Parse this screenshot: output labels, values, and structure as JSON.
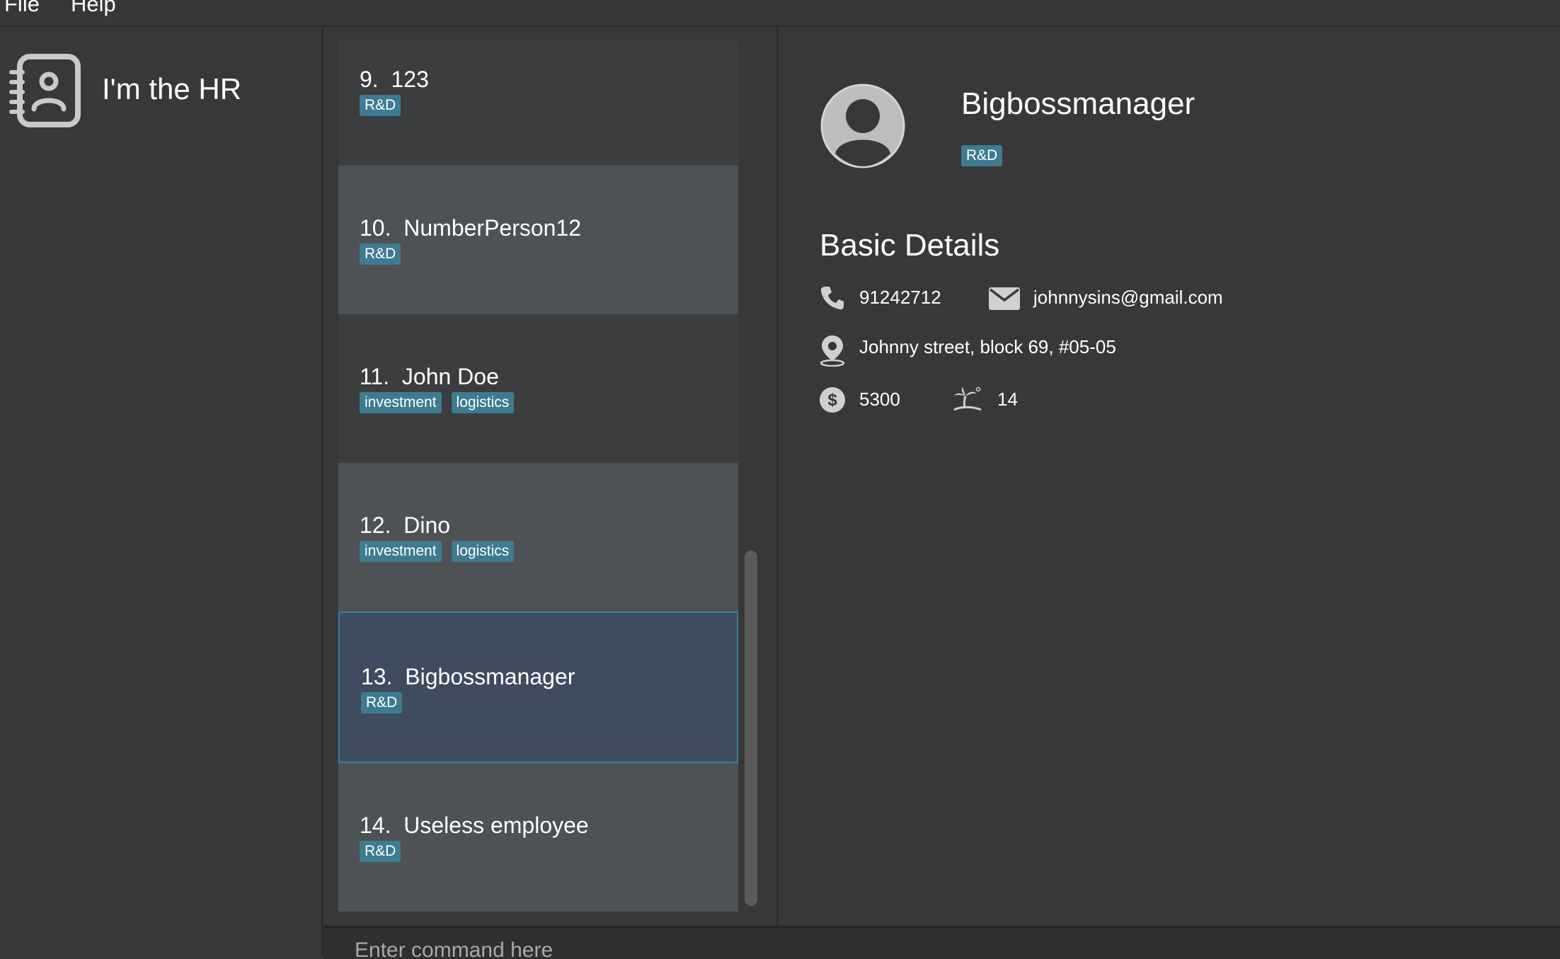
{
  "menu": {
    "items": [
      {
        "label": "File"
      },
      {
        "label": "Help"
      }
    ]
  },
  "sidebar": {
    "title": "I'm the HR",
    "logo_icon": "address-book-icon"
  },
  "persons": [
    {
      "index": "9.",
      "name": "123",
      "tags": [
        "R&D"
      ],
      "selected": false
    },
    {
      "index": "10.",
      "name": "NumberPerson12",
      "tags": [
        "R&D"
      ],
      "selected": false
    },
    {
      "index": "11.",
      "name": "John Doe",
      "tags": [
        "investment",
        "logistics"
      ],
      "selected": false
    },
    {
      "index": "12.",
      "name": "Dino",
      "tags": [
        "investment",
        "logistics"
      ],
      "selected": false
    },
    {
      "index": "13.",
      "name": "Bigbossmanager",
      "tags": [
        "R&D"
      ],
      "selected": true
    },
    {
      "index": "14.",
      "name": "Useless employee",
      "tags": [
        "R&D"
      ],
      "selected": false
    }
  ],
  "detail": {
    "name": "Bigbossmanager",
    "tags": [
      "R&D"
    ],
    "section_heading": "Basic Details",
    "phone": "91242712",
    "email": "johnnysins@gmail.com",
    "address": "Johnny street, block 69, #05-05",
    "salary": "5300",
    "leaves": "14",
    "icons": {
      "avatar": "user-avatar-icon",
      "phone": "phone-icon",
      "email": "envelope-icon",
      "address": "map-pin-icon",
      "salary": "dollar-icon",
      "leaves": "beach-island-icon"
    }
  },
  "command": {
    "placeholder": "Enter command here"
  },
  "colors": {
    "background": "#383838",
    "tag": "#3e7b91",
    "card_dark": "#3b3d3f",
    "card_light": "#4f5254",
    "card_selected": "#3f4b5f",
    "selected_border": "#3a7ea4"
  }
}
